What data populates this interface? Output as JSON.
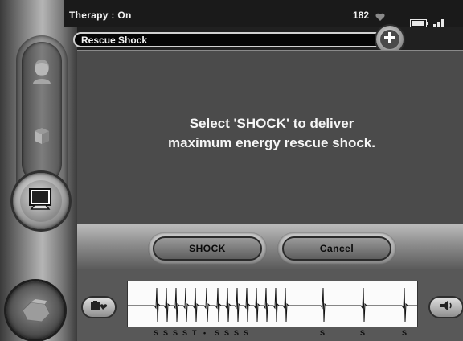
{
  "status": {
    "therapy_label": "Therapy : On",
    "heart_rate": "182",
    "heart_icon": "heart-icon",
    "battery_icon": "battery-icon",
    "signal_icon": "signal-icon"
  },
  "header": {
    "title": "Rescue Shock",
    "add_icon": "plus-icon"
  },
  "message": {
    "line1": "Select 'SHOCK' to deliver",
    "line2": "maximum energy rescue shock."
  },
  "buttons": {
    "shock_label": "SHOCK",
    "cancel_label": "Cancel"
  },
  "sidebar": {
    "items": [
      {
        "icon": "patient-icon"
      },
      {
        "icon": "cube-icon"
      },
      {
        "icon": "monitor-icon"
      },
      {
        "icon": "hand-icon"
      }
    ]
  },
  "ecg": {
    "markers": [
      "S",
      "S",
      "S",
      "S",
      "T",
      "•",
      "S",
      "S",
      "S",
      "S",
      "S",
      "S",
      "S"
    ],
    "left_button_icon": "camera-heart-icon",
    "right_button_icon": "speaker-icon"
  },
  "colors": {
    "message_bg": "#4b4b4b",
    "header_bg": "#050505",
    "text": "#f5f5f5"
  }
}
